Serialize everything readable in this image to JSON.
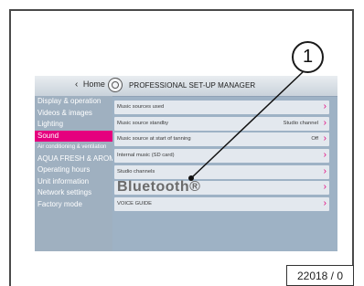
{
  "header": {
    "home_label": "Home",
    "title": "PROFESSIONAL SET-UP MANAGER"
  },
  "sidebar": {
    "active_color": "#e5007e",
    "items": [
      {
        "label": "Display & operation"
      },
      {
        "label": "Videos & images"
      },
      {
        "label": "Lighting"
      },
      {
        "label": "Sound",
        "active": true
      },
      {
        "label": "Air conditioning & ventilation"
      },
      {
        "label": "AQUA FRESH & AROMA"
      },
      {
        "label": "Operating hours"
      },
      {
        "label": "Unit information"
      },
      {
        "label": "Network settings"
      },
      {
        "label": "Factory mode"
      }
    ]
  },
  "settings_rows": [
    {
      "label": "Music sources used",
      "value": ""
    },
    {
      "label": "Music source standby",
      "value": "Studio channel"
    },
    {
      "label": "Music source at start of tanning",
      "value": "Off"
    },
    {
      "label": "Internal music (SD card)",
      "value": ""
    },
    {
      "label": "Studio channels",
      "value": ""
    },
    {
      "label": "Bluetooth®",
      "value": ""
    },
    {
      "label": "VOICE GUIDE",
      "value": ""
    }
  ],
  "icons": {
    "home_chevron": "chevron-left-icon",
    "row_arrow": "chevron-right-icon",
    "title_icon": "settings-icon"
  },
  "annotation": {
    "callout_number": "1",
    "reference_code": "22018 / 0"
  }
}
